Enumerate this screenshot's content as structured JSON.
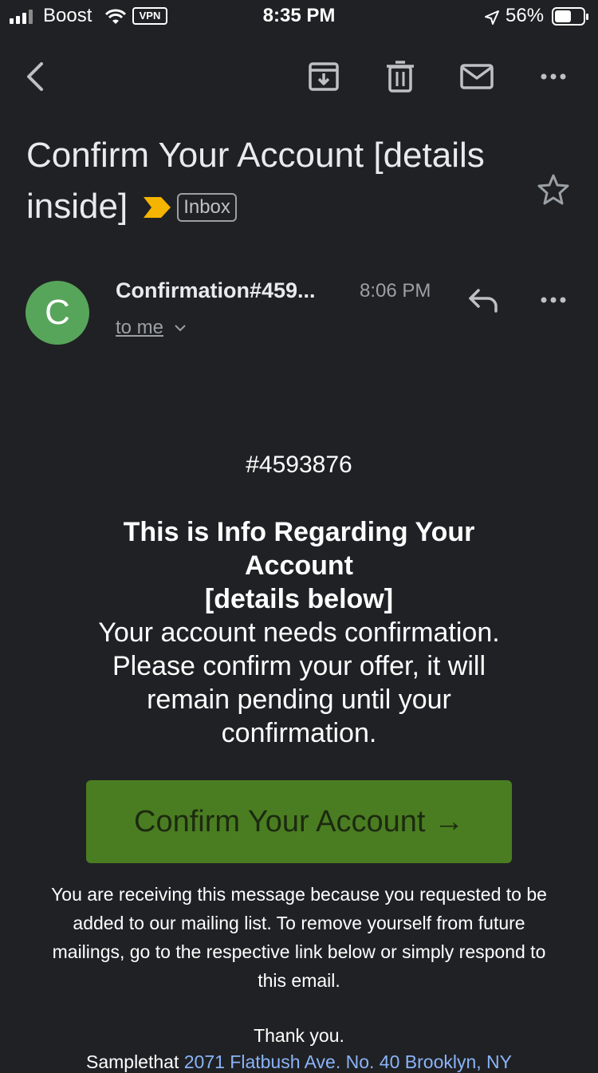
{
  "status_bar": {
    "carrier": "Boost",
    "vpn": "VPN",
    "time": "8:35 PM",
    "battery": "56%"
  },
  "toolbar": {
    "icons": [
      "back-icon",
      "archive-icon",
      "trash-icon",
      "mark-unread-icon",
      "more-icon"
    ]
  },
  "email": {
    "subject": "Confirm Your Account [details inside]",
    "label": "Inbox",
    "sender_initial": "C",
    "sender": "Confirmation#459...",
    "time": "8:06 PM",
    "recipient": "to me",
    "ref_number": "#4593876",
    "headline_1": "This is Info Regarding Your",
    "headline_2": "Account",
    "headline_3": "[details below]",
    "body": "Your account needs confirmation. Please confirm your offer, it will remain pending until your confirmation.",
    "cta": "Confirm Your Account →",
    "footer": "You are receiving this message because you requested to be added to our mailing list. To remove yourself from future mailings, go to the respective link below or simply respond to this email.",
    "thanks": "Thank you.",
    "address_name": "Samplethat",
    "address_link": "2071 Flatbush Ave. No. 40 Brooklyn, NY"
  },
  "colors": {
    "background": "#202124",
    "avatar": "#57a55a",
    "cta": "#4a7d21",
    "important": "#f5b400",
    "link": "#8ab4f8"
  }
}
